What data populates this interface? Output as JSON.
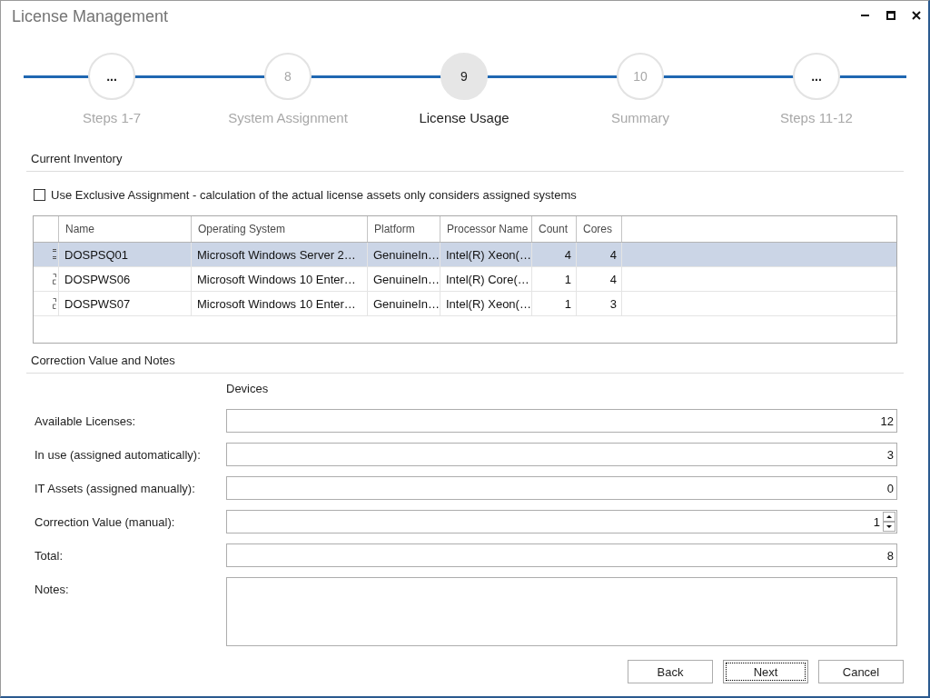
{
  "window": {
    "title": "License Management"
  },
  "steps": [
    {
      "kind": "more",
      "number": "...",
      "label": "Steps 1-7",
      "selected": false
    },
    {
      "kind": "step",
      "number": "8",
      "label": "System Assignment",
      "selected": false
    },
    {
      "kind": "step",
      "number": "9",
      "label": "License Usage",
      "selected": true
    },
    {
      "kind": "step",
      "number": "10",
      "label": "Summary",
      "selected": false
    },
    {
      "kind": "more",
      "number": "...",
      "label": "Steps 11-12",
      "selected": false
    }
  ],
  "inventory": {
    "heading": "Current Inventory",
    "exclusive_assignment": {
      "label": "Use Exclusive Assignment - calculation of the actual license assets only considers assigned systems",
      "checked": false
    },
    "table": {
      "columns": [
        {
          "kind": "text",
          "label": "Name"
        },
        {
          "kind": "text",
          "label": "Operating System"
        },
        {
          "kind": "text",
          "label": "Platform"
        },
        {
          "kind": "text",
          "label": "Processor Name"
        },
        {
          "kind": "number",
          "label": "Count"
        },
        {
          "kind": "number",
          "label": "Cores"
        }
      ],
      "rows": [
        {
          "selected": true,
          "cells": [
            "DOSPSQ01",
            "Microsoft Windows Server 2…",
            "GenuineIn…",
            "Intel(R) Xeon(…",
            "4",
            "4"
          ]
        },
        {
          "selected": false,
          "cells": [
            "DOSPWS06",
            "Microsoft Windows 10 Enter…",
            "GenuineIn…",
            "Intel(R) Core(…",
            "1",
            "4"
          ]
        },
        {
          "selected": false,
          "cells": [
            "DOSPWS07",
            "Microsoft Windows 10 Enter…",
            "GenuineIn…",
            "Intel(R) Xeon(…",
            "1",
            "3"
          ]
        }
      ]
    }
  },
  "correction": {
    "heading": "Correction Value and Notes",
    "column_heading": "Devices",
    "fields": [
      {
        "kind": "number",
        "label": "Available Licenses:",
        "value": "12"
      },
      {
        "kind": "number",
        "label": "In use (assigned automatically):",
        "value": "3"
      },
      {
        "kind": "number",
        "label": "IT Assets (assigned manually):",
        "value": "0"
      },
      {
        "kind": "spin",
        "label": "Correction Value (manual):",
        "value": "1"
      },
      {
        "kind": "number",
        "label": "Total:",
        "value": "8"
      },
      {
        "kind": "notes",
        "label": "Notes:"
      }
    ]
  },
  "buttons": [
    {
      "label": "Back",
      "focused": false
    },
    {
      "label": "Next",
      "focused": true
    },
    {
      "label": "Cancel",
      "focused": false
    }
  ]
}
